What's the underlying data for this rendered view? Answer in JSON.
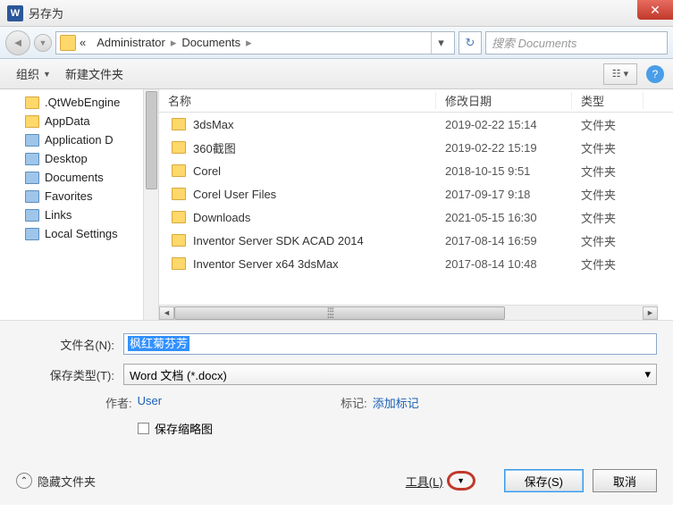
{
  "title": "另存为",
  "close_icon": "✕",
  "nav": {
    "back": "◄",
    "fwd": "▼",
    "refresh": "↻"
  },
  "breadcrumb": {
    "chev": "«",
    "seg1": "Administrator",
    "seg2": "Documents",
    "sep": "▸",
    "dd": "▾"
  },
  "search": {
    "placeholder": "搜索 Documents"
  },
  "toolbar": {
    "organize": "组织",
    "newfolder": "新建文件夹",
    "view": "☷ ▾",
    "help": "?"
  },
  "sidebar": {
    "items": [
      {
        "label": ".QtWebEngine",
        "sp": false
      },
      {
        "label": "AppData",
        "sp": false
      },
      {
        "label": "Application D",
        "sp": true
      },
      {
        "label": "Desktop",
        "sp": true
      },
      {
        "label": "Documents",
        "sp": true
      },
      {
        "label": "Favorites",
        "sp": true
      },
      {
        "label": "Links",
        "sp": true
      },
      {
        "label": "Local Settings",
        "sp": true
      }
    ]
  },
  "filelist": {
    "cols": {
      "name": "名称",
      "date": "修改日期",
      "type": "类型"
    },
    "rows": [
      {
        "name": "3dsMax",
        "date": "2019-02-22 15:14",
        "type": "文件夹"
      },
      {
        "name": "360截图",
        "date": "2019-02-22 15:19",
        "type": "文件夹"
      },
      {
        "name": "Corel",
        "date": "2018-10-15 9:51",
        "type": "文件夹"
      },
      {
        "name": "Corel User Files",
        "date": "2017-09-17 9:18",
        "type": "文件夹"
      },
      {
        "name": "Downloads",
        "date": "2021-05-15 16:30",
        "type": "文件夹"
      },
      {
        "name": "Inventor Server SDK ACAD 2014",
        "date": "2017-08-14 16:59",
        "type": "文件夹"
      },
      {
        "name": "Inventor Server x64 3dsMax",
        "date": "2017-08-14 10:48",
        "type": "文件夹"
      }
    ]
  },
  "form": {
    "filename_label": "文件名(N):",
    "filename_value": "枫红菊芬芳",
    "filetype_label": "保存类型(T):",
    "filetype_value": "Word 文档 (*.docx)",
    "author_label": "作者:",
    "author_value": "User",
    "tag_label": "标记:",
    "tag_value": "添加标记",
    "thumbnail_label": "保存缩略图"
  },
  "bottom": {
    "hide": "隐藏文件夹",
    "tools": "工具(L)",
    "save": "保存(S)",
    "cancel": "取消",
    "arrow": "▼",
    "up": "⌃"
  }
}
